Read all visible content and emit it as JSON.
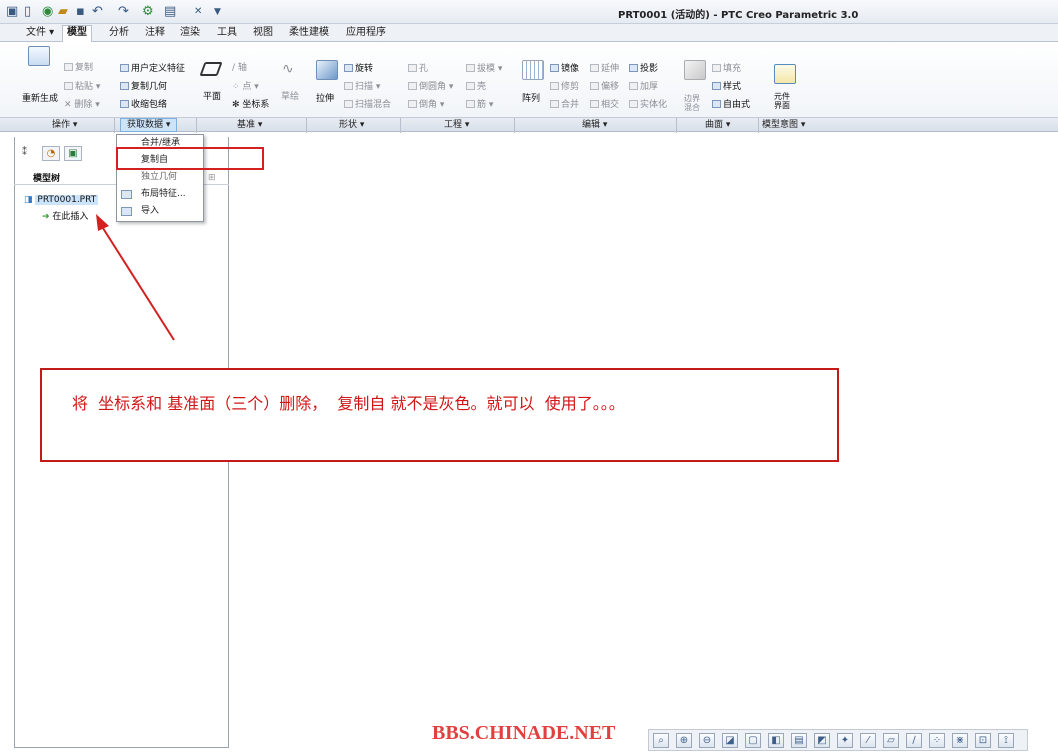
{
  "window": {
    "title": "PRT0001 (活动的) - PTC Creo Parametric 3.0"
  },
  "quick_access": {
    "icons": [
      "app-menu-icon",
      "new-icon",
      "open-icon",
      "folder-icon",
      "save-icon",
      "undo-icon",
      "redo-icon",
      "regenerate-icon",
      "windows-icon",
      "close-icon",
      "customize-icon"
    ]
  },
  "tabs": [
    {
      "label": "文件 ▾"
    },
    {
      "label": "模型"
    },
    {
      "label": "分析"
    },
    {
      "label": "注释"
    },
    {
      "label": "渲染"
    },
    {
      "label": "工具"
    },
    {
      "label": "视图"
    },
    {
      "label": "柔性建模"
    },
    {
      "label": "应用程序"
    }
  ],
  "ribbon": {
    "operations": {
      "regenerate": "重新生成",
      "copy": "复制",
      "paste": "粘贴 ▾",
      "delete": "删除 ▾"
    },
    "get_data": {
      "udf": "用户定义特征",
      "copy_geom": "复制几何",
      "shrinkwrap": "收缩包络"
    },
    "datum": {
      "plane": "平面",
      "axis": "轴",
      "point": "点 ▾",
      "csys": "坐标系",
      "sketch": "草绘"
    },
    "shapes": {
      "extrude": "拉伸",
      "revolve": "旋转",
      "sweep": "扫描 ▾",
      "swept_blend": "扫描混合"
    },
    "engineering": {
      "hole": "孔",
      "round": "倒圆角 ▾",
      "chamfer": "倒角 ▾",
      "draft": "拔模 ▾",
      "shell": "壳",
      "rib": "筋 ▾"
    },
    "editing": {
      "pattern": "阵列",
      "mirror": "镜像",
      "trim": "修剪",
      "merge": "合并",
      "extend": "延伸",
      "offset": "偏移",
      "intersect": "相交",
      "project": "投影",
      "thicken": "加厚",
      "solidify": "实体化"
    },
    "surfaces": {
      "boundary_blend": "边界混合",
      "fill": "填充",
      "style": "样式",
      "freestyle": "自由式"
    },
    "model_intent": {
      "component_interface": "元件界面"
    }
  },
  "groups": [
    {
      "label": "操作 ▾"
    },
    {
      "label": "获取数据 ▾"
    },
    {
      "label": "基准 ▾"
    },
    {
      "label": "形状 ▾"
    },
    {
      "label": "工程 ▾"
    },
    {
      "label": "编辑 ▾"
    },
    {
      "label": "曲面 ▾"
    },
    {
      "label": "模型意图 ▾"
    }
  ],
  "dropdown": {
    "items": [
      {
        "label": "合并/继承"
      },
      {
        "label": "复制自"
      },
      {
        "label": "独立几何"
      },
      {
        "label": "布局特征..."
      },
      {
        "label": "导入"
      }
    ]
  },
  "model_tree": {
    "title": "模型树",
    "root": "PRT0001.PRT",
    "insert_here": "在此插入"
  },
  "annotation": {
    "text": "将  坐标系和 基准面（三个）删除，  复制自 就不是灰色。就可以  使用了。。。",
    "color": "#d11616"
  },
  "watermark": {
    "text": "BBS.CHINADE.NET"
  },
  "view_toolbar": {
    "icons": [
      "refit-icon",
      "zoom-in-icon",
      "zoom-out-icon",
      "repaint-icon",
      "saved-views-icon",
      "display-style-icon",
      "view-manager-icon",
      "plane-display-icon",
      "axis-display-icon",
      "point-display-icon",
      "csys-display-icon",
      "spin-center-icon",
      "annotation-display-icon",
      "perspective-icon",
      "orient-icon",
      "section-icon"
    ]
  }
}
